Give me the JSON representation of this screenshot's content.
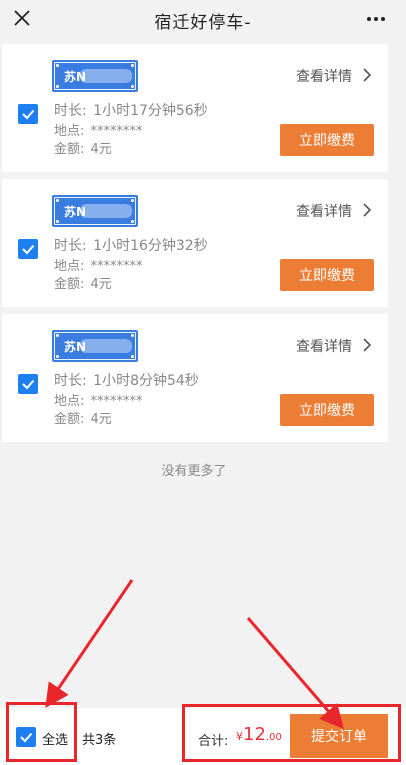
{
  "nav": {
    "title": "宿迁好停车-",
    "close_icon": "close-icon",
    "more_icon": "more-dots-icon"
  },
  "cards": [
    {
      "plate": "苏N",
      "detail_label": "查看详情",
      "duration_label": "时长:",
      "duration": "1小时17分钟56秒",
      "location_label": "地点:",
      "location": "********",
      "amount_label": "金额:",
      "amount": "4元",
      "pay_label": "立即缴费",
      "checked": true
    },
    {
      "plate": "苏N",
      "detail_label": "查看详情",
      "duration_label": "时长:",
      "duration": "1小时16分钟32秒",
      "location_label": "地点:",
      "location": "********",
      "amount_label": "金额:",
      "amount": "4元",
      "pay_label": "立即缴费",
      "checked": true
    },
    {
      "plate": "苏N",
      "detail_label": "查看详情",
      "duration_label": "时长:",
      "duration": "1小时8分钟54秒",
      "location_label": "地点:",
      "location": "********",
      "amount_label": "金额:",
      "amount": "4元",
      "pay_label": "立即缴费",
      "checked": true
    }
  ],
  "list_end_text": "没有更多了",
  "footer": {
    "select_all_label": "全选",
    "count_text": "共3条",
    "total_label": "合计:",
    "currency": "¥",
    "total_int": "12",
    "total_dec": ".00",
    "submit_label": "提交订单"
  },
  "colors": {
    "accent_blue": "#1e80f0",
    "plate_blue": "#3a7de0",
    "button_orange": "#ec7d34",
    "price_red": "#e8313a",
    "annotation_red": "#e8262c"
  }
}
